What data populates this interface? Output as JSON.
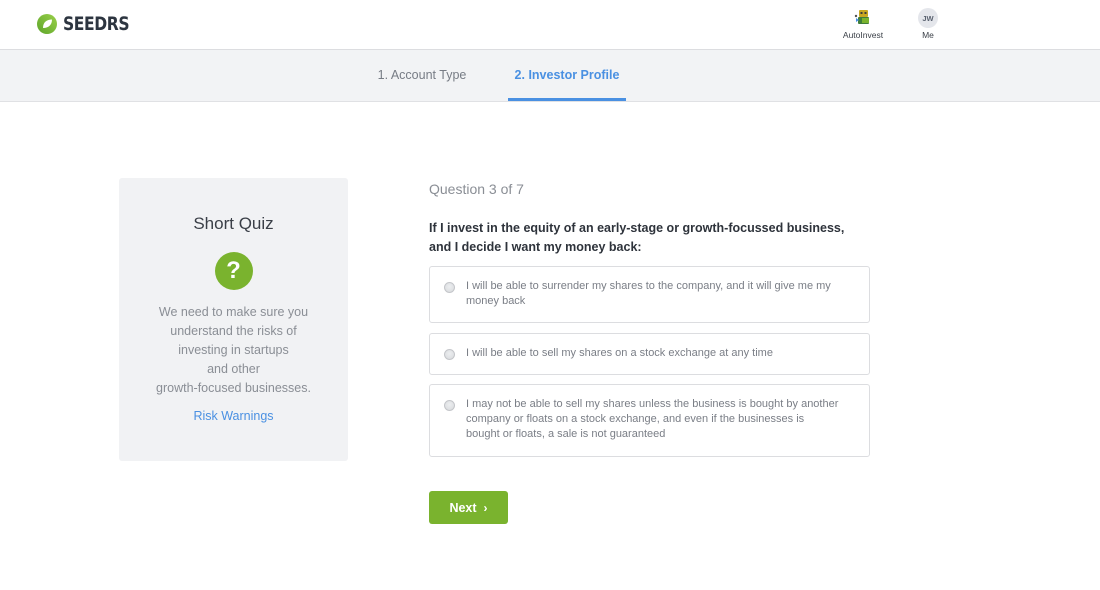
{
  "header": {
    "logo_text": "SEEDRS",
    "nav": [
      {
        "label": "AutoInvest",
        "icon": "robot-icon"
      },
      {
        "label": "Me",
        "avatar_initials": "JW"
      }
    ]
  },
  "steps": [
    {
      "label": "1. Account Type",
      "active": false
    },
    {
      "label": "2. Investor Profile",
      "active": true
    }
  ],
  "info_card": {
    "title": "Short Quiz",
    "icon": "question-mark-icon",
    "icon_glyph": "?",
    "text_lines": [
      "We need to make sure you",
      "understand the risks of",
      "investing in startups",
      "and other",
      "growth-focused businesses."
    ],
    "link_label": "Risk Warnings"
  },
  "question": {
    "counter": "Question 3 of 7",
    "text": "If I invest in the equity of an early-stage or growth-focussed business, and I decide I want my money back:",
    "options": [
      {
        "lines": [
          "I will be able to surrender my shares to the company, and it will give me my",
          "money back"
        ],
        "selected": false
      },
      {
        "lines": [
          "I will be able to sell my shares on a stock exchange at any time"
        ],
        "selected": false
      },
      {
        "lines": [
          "I may not be able to sell my shares unless the business is bought by another",
          "company or floats on a stock exchange, and even if the businesses is",
          "bought or floats, a sale is not guaranteed"
        ],
        "selected": false
      }
    ]
  },
  "actions": {
    "next_label": "Next",
    "next_chevron": "›"
  },
  "colors": {
    "brand_green": "#7ab32e",
    "accent_blue": "#4a90e2"
  }
}
